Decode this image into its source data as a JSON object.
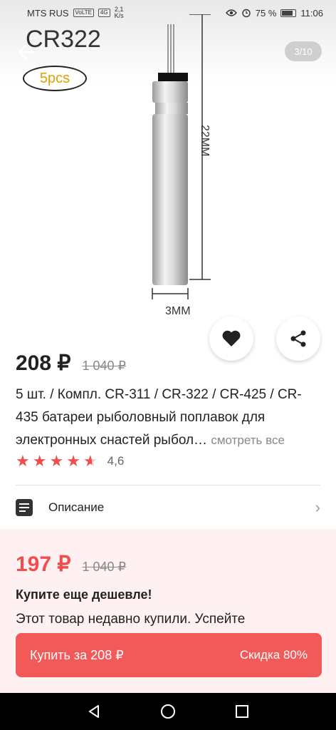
{
  "status_bar": {
    "carrier": "MTS RUS",
    "volte": "VoLTE",
    "network": "4G",
    "speed_value": "2,1",
    "speed_unit": "K/s",
    "battery": "75 %",
    "time": "11:06"
  },
  "gallery": {
    "image_title": "CR322",
    "image_badge": "5pcs",
    "dim_height": "22MM",
    "dim_width": "3MM",
    "counter": "3/10"
  },
  "product": {
    "price": "208 ₽",
    "old_price": "1 040 ₽",
    "title": "5 шт. / Компл. CR-311 / CR-322 / CR-425 / CR-435 батареи рыболовный поплавок для электронных снастей рыбол…",
    "see_all": "смотреть все",
    "rating": "4,6",
    "rating_stars": 4.6
  },
  "description": {
    "label": "Описание"
  },
  "promo": {
    "price": "197 ₽",
    "old_price": "1 040 ₽",
    "heading": "Купите еще дешевле!",
    "text": "Этот товар недавно купили. Успейте"
  },
  "buy_button": {
    "label": "Купить за 208 ₽",
    "discount": "Скидка 80%"
  },
  "colors": {
    "accent": "#f04d4d",
    "button": "#f25a5a",
    "promo_bg": "#fff1f1"
  }
}
